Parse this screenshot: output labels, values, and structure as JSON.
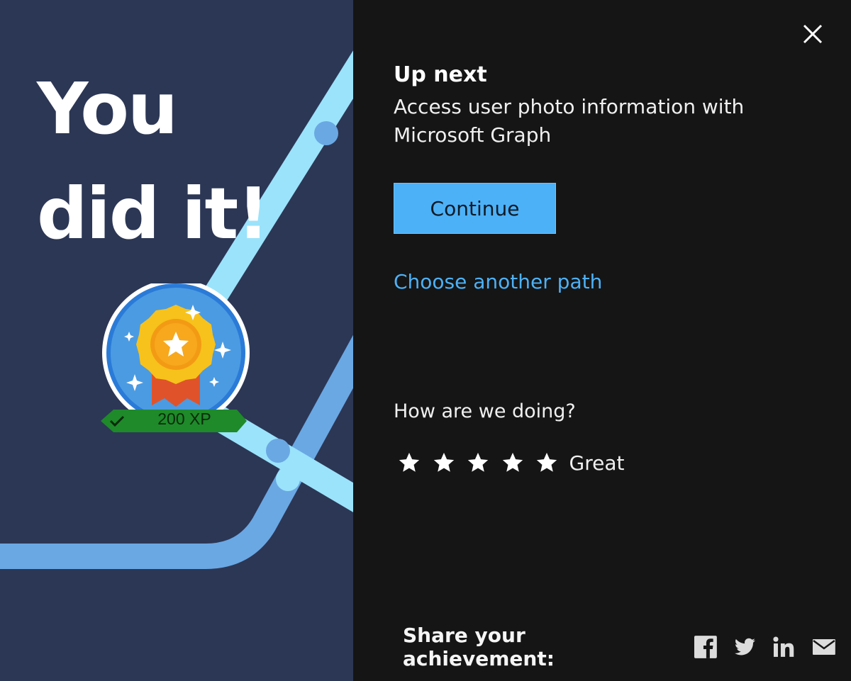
{
  "hero": {
    "line1": "You",
    "line2": "did it!"
  },
  "badge": {
    "xp_label": "200 XP"
  },
  "panel": {
    "up_next": "Up next",
    "unit_title": "Access user photo information with Microsoft Graph",
    "continue_label": "Continue",
    "another_path": "Choose another path",
    "feedback_question": "How are we doing?",
    "rating": {
      "stars": 5,
      "max": 5,
      "label": "Great"
    },
    "share_label": "Share your achievement:"
  },
  "share_icons": [
    "facebook-icon",
    "twitter-icon",
    "linkedin-icon",
    "mail-icon"
  ],
  "colors": {
    "left_bg": "#2c3755",
    "right_bg": "#151515",
    "accent": "#4db1f7",
    "path_light": "#9be3fb",
    "path_mid": "#6aa8e4",
    "xp_ribbon": "#1e8a2a"
  }
}
